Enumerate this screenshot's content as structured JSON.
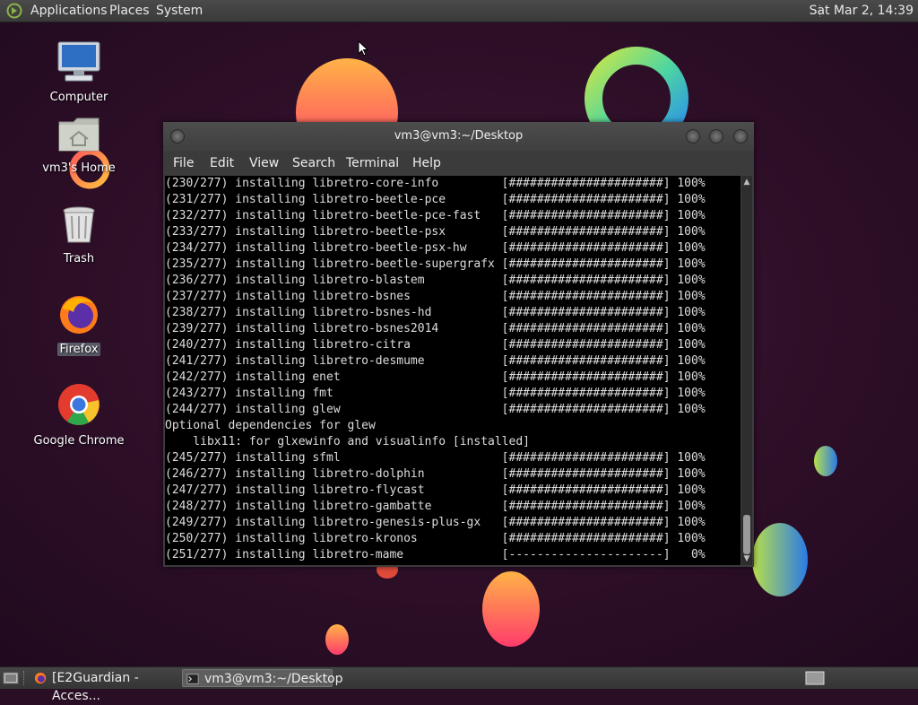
{
  "top_panel": {
    "menus": [
      "Applications",
      "Places",
      "System"
    ],
    "clock": "Sat Mar  2, 14:39"
  },
  "desktop": {
    "icons": [
      {
        "label": "Computer",
        "icon": "computer-icon"
      },
      {
        "label": "vm3's Home",
        "icon": "home-folder-icon"
      },
      {
        "label": "Trash",
        "icon": "trash-icon"
      },
      {
        "label": "Firefox",
        "icon": "firefox-icon"
      },
      {
        "label": "Google Chrome",
        "icon": "chrome-icon"
      }
    ]
  },
  "terminal": {
    "title": "vm3@vm3:~/Desktop",
    "menu": [
      "File",
      "Edit",
      "View",
      "Search",
      "Terminal",
      "Help"
    ],
    "lines": [
      "(230/277) installing libretro-core-info         [######################] 100%",
      "(231/277) installing libretro-beetle-pce        [######################] 100%",
      "(232/277) installing libretro-beetle-pce-fast   [######################] 100%",
      "(233/277) installing libretro-beetle-psx        [######################] 100%",
      "(234/277) installing libretro-beetle-psx-hw     [######################] 100%",
      "(235/277) installing libretro-beetle-supergrafx [######################] 100%",
      "(236/277) installing libretro-blastem           [######################] 100%",
      "(237/277) installing libretro-bsnes             [######################] 100%",
      "(238/277) installing libretro-bsnes-hd          [######################] 100%",
      "(239/277) installing libretro-bsnes2014         [######################] 100%",
      "(240/277) installing libretro-citra             [######################] 100%",
      "(241/277) installing libretro-desmume           [######################] 100%",
      "(242/277) installing enet                       [######################] 100%",
      "(243/277) installing fmt                        [######################] 100%",
      "(244/277) installing glew                       [######################] 100%",
      "Optional dependencies for glew",
      "    libx11: for glxewinfo and visualinfo [installed]",
      "(245/277) installing sfml                       [######################] 100%",
      "(246/277) installing libretro-dolphin           [######################] 100%",
      "(247/277) installing libretro-flycast           [######################] 100%",
      "(248/277) installing libretro-gambatte          [######################] 100%",
      "(249/277) installing libretro-genesis-plus-gx   [######################] 100%",
      "(250/277) installing libretro-kronos            [######################] 100%",
      "(251/277) installing libretro-mame              [----------------------]   0%"
    ]
  },
  "taskbar": {
    "tasks": [
      {
        "label": "[E2Guardian - Acces...",
        "icon": "firefox-icon",
        "active": false
      },
      {
        "label": "vm3@vm3:~/Desktop",
        "icon": "terminal-icon",
        "active": true
      }
    ]
  }
}
